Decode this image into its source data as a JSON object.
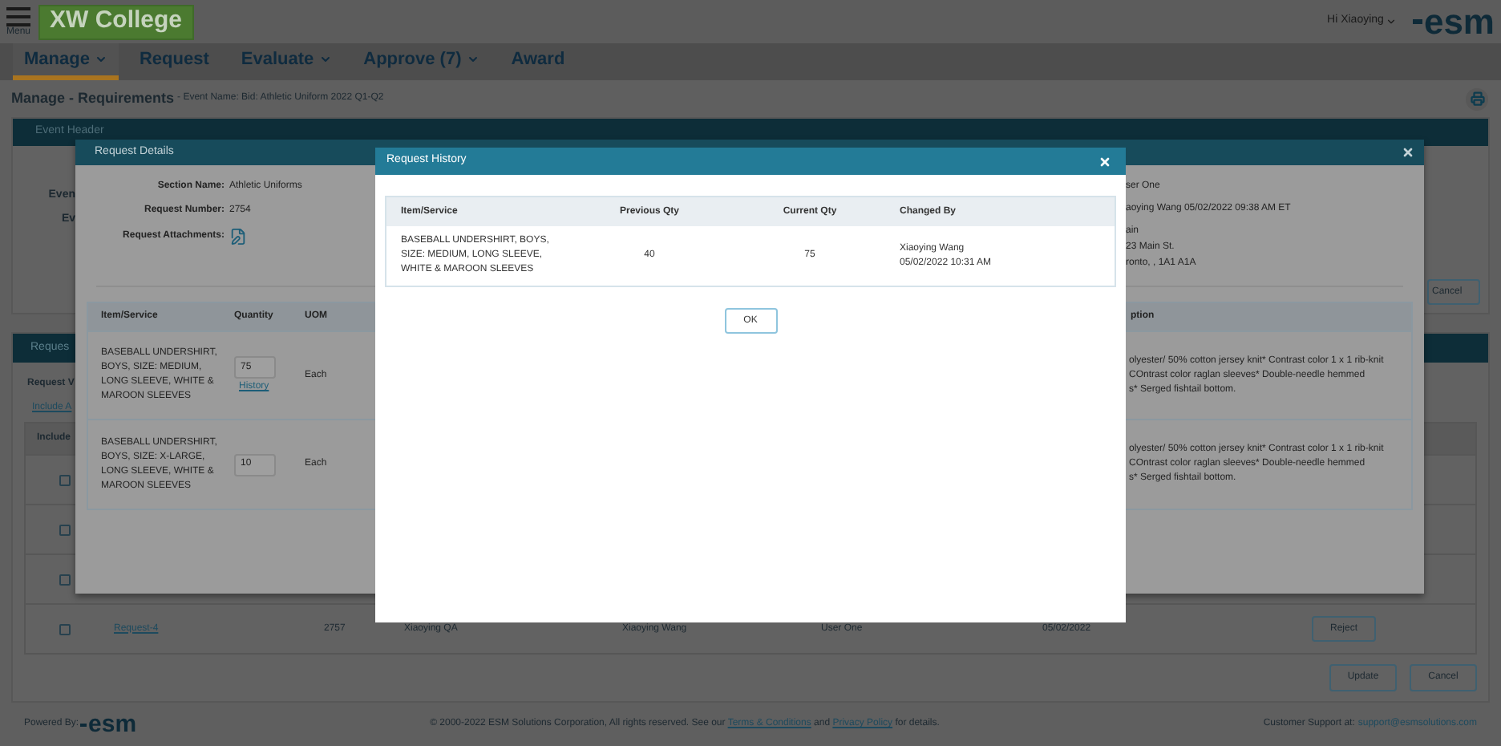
{
  "header": {
    "menu_label": "Menu",
    "logo": "XW College",
    "greeting": "Hi Xiaoying",
    "brand": "esm"
  },
  "nav": [
    {
      "label": "Manage",
      "dropdown": true,
      "selected": true
    },
    {
      "label": "Request",
      "dropdown": false,
      "selected": false
    },
    {
      "label": "Evaluate",
      "dropdown": true,
      "selected": false
    },
    {
      "label": "Approve (7)",
      "dropdown": true,
      "selected": false
    },
    {
      "label": "Award",
      "dropdown": false,
      "selected": false
    }
  ],
  "breadcrumb": {
    "title": "Manage - Requirements",
    "subtitle": "- Event Name: Bid: Athletic Uniform 2022 Q1-Q2"
  },
  "event_header": {
    "title": "Event Header",
    "labels": [
      "Even",
      "Ev"
    ],
    "button": "Cancel"
  },
  "requests_panel": {
    "title": "Reques",
    "label": "Request V",
    "link": "Include A",
    "column_1": "Include",
    "rows": [
      {
        "checked": false
      },
      {
        "checked": false
      },
      {
        "checked": false
      },
      {
        "checked": false,
        "request": "Request-4",
        "number": "2757",
        "column_4": "Xiaoying QA",
        "column_5": "Xiaoying Wang",
        "column_6": "User One",
        "date": "05/02/2022",
        "button": "Reject"
      }
    ],
    "buttons": [
      "Update",
      "Cancel"
    ]
  },
  "footer": {
    "powered_by": "Powered By:",
    "brand": "esm",
    "copyright_before": "© 2000-2022 ESM Solutions Corporation, All rights reserved. See our",
    "terms_link": "Terms & Conditions",
    "copyright_middle": "and",
    "privacy_link": "Privacy Policy",
    "copyright_after": "for details.",
    "support_label": "Customer Support at:",
    "support_email": "support@esmsolutions.com"
  },
  "request_details": {
    "title": "Request Details",
    "fields": [
      {
        "kind": "text",
        "label": "Section Name:",
        "value": "Athletic Uniforms"
      },
      {
        "kind": "text",
        "label": "Request Number:",
        "value": "2754"
      },
      {
        "kind": "attachment",
        "label": "Request Attachments:"
      }
    ],
    "right_lines": [
      [
        "ser One"
      ],
      [
        "aoying Wang 05/02/2022 09:38 AM ET"
      ],
      [
        "ain",
        "23 Main St.",
        "ronto, , 1A1 A1A"
      ]
    ],
    "table": {
      "columns": [
        "Item/Service",
        "Quantity",
        "UOM",
        "ption"
      ],
      "rows": [
        {
          "item": "BASEBALL UNDERSHIRT, BOYS, SIZE: MEDIUM, LONG SLEEVE, WHITE & MAROON SLEEVES",
          "quantity": "75",
          "history_link": "History",
          "uom": "Each",
          "description": [
            "olyester/ 50% cotton jersey knit* Contrast color 1 x 1 rib-knit",
            "COntrast color raglan sleeves* Double-needle hemmed",
            "s* Serged fishtail bottom."
          ]
        },
        {
          "item": "BASEBALL UNDERSHIRT, BOYS, SIZE: X-LARGE, LONG SLEEVE, WHITE & MAROON SLEEVES",
          "quantity": "10",
          "uom": "Each",
          "description": [
            "olyester/ 50% cotton jersey knit* Contrast color 1 x 1 rib-knit",
            "COntrast color raglan sleeves* Double-needle hemmed",
            "s* Serged fishtail bottom."
          ]
        }
      ]
    }
  },
  "request_history": {
    "title": "Request History",
    "columns": [
      "Item/Service",
      "Previous Qty",
      "Current Qty",
      "Changed By"
    ],
    "rows": [
      {
        "item": "BASEBALL UNDERSHIRT, BOYS, SIZE: MEDIUM, LONG SLEEVE, WHITE & MAROON SLEEVES",
        "previous_qty": "40",
        "current_qty": "75",
        "changed_by": "Xiaoying Wang",
        "changed_at": "05/02/2022 10:31 AM"
      }
    ],
    "button": "OK"
  }
}
